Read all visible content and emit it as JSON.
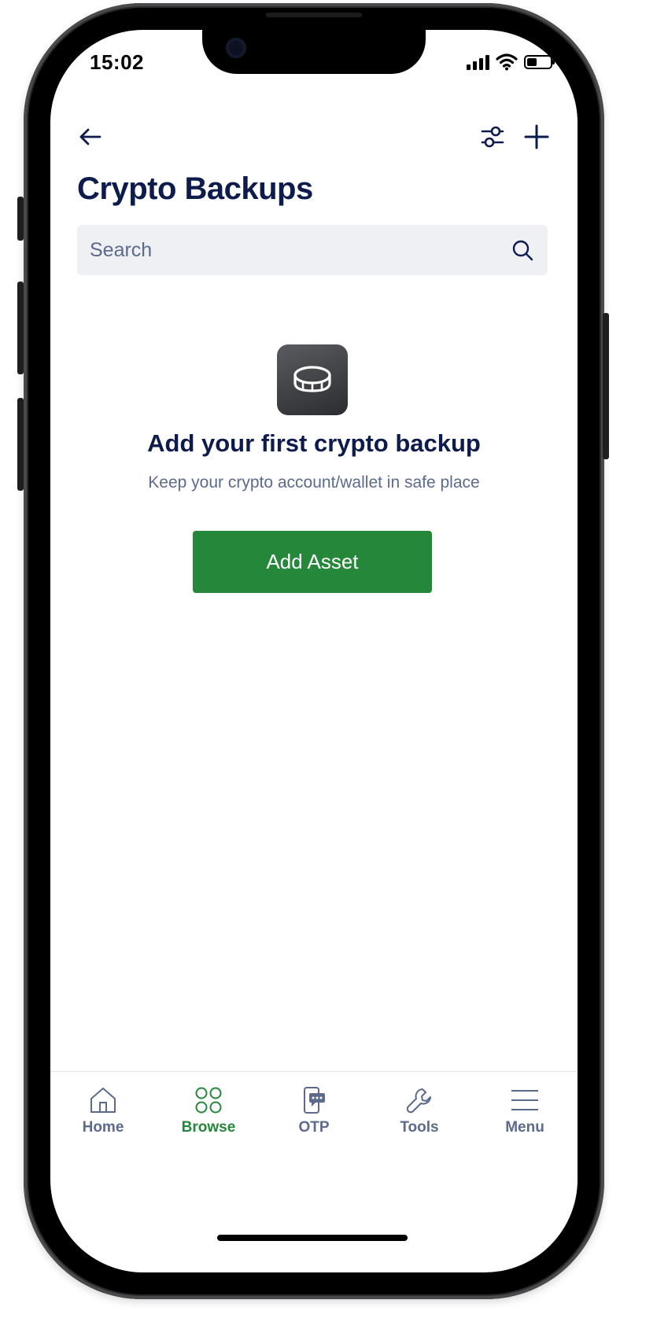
{
  "status_bar": {
    "time": "15:02"
  },
  "header": {
    "back_icon": "arrow-left-icon",
    "filter_icon": "sliders-icon",
    "add_icon": "plus-icon",
    "title": "Crypto Backups"
  },
  "search": {
    "placeholder": "Search",
    "value": "",
    "icon": "search-icon"
  },
  "empty_state": {
    "icon": "coin-icon",
    "title": "Add your first crypto backup",
    "subtitle": "Keep your crypto account/wallet in safe place",
    "button_label": "Add Asset"
  },
  "tabbar": {
    "items": [
      {
        "label": "Home",
        "icon": "home-icon",
        "active": false
      },
      {
        "label": "Browse",
        "icon": "grid-circles-icon",
        "active": true
      },
      {
        "label": "OTP",
        "icon": "phone-message-icon",
        "active": false
      },
      {
        "label": "Tools",
        "icon": "wrench-icon",
        "active": false
      },
      {
        "label": "Menu",
        "icon": "hamburger-icon",
        "active": false
      }
    ]
  },
  "colors": {
    "primary_navy": "#0e1b4d",
    "accent_green": "#258739",
    "muted_text": "#5c6a8c",
    "search_bg": "#eff0f4"
  }
}
